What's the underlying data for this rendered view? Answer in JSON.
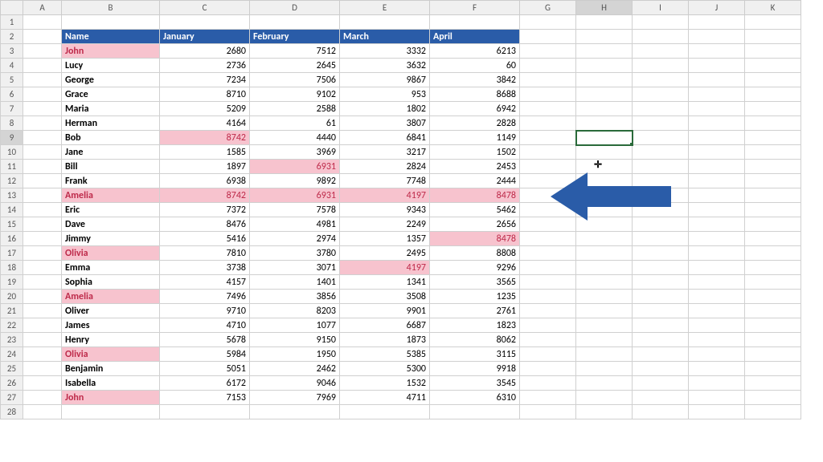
{
  "columns": {
    "A": 48,
    "B": 122,
    "C": 112,
    "D": 112,
    "E": 112,
    "F": 112,
    "G": 70,
    "H": 70,
    "I": 70,
    "J": 70,
    "K": 70
  },
  "header": {
    "name": "Name",
    "jan": "January",
    "feb": "February",
    "mar": "March",
    "apr": "April"
  },
  "rows": [
    {
      "n": "John",
      "jan": 2680,
      "feb": 7512,
      "mar": 3332,
      "apr": 6213,
      "np": true
    },
    {
      "n": "Lucy",
      "jan": 2736,
      "feb": 2645,
      "mar": 3632,
      "apr": 60
    },
    {
      "n": "George",
      "jan": 7234,
      "feb": 7506,
      "mar": 9867,
      "apr": 3842
    },
    {
      "n": "Grace",
      "jan": 8710,
      "feb": 9102,
      "mar": 953,
      "apr": 8688
    },
    {
      "n": "Maria",
      "jan": 5209,
      "feb": 2588,
      "mar": 1802,
      "apr": 6942
    },
    {
      "n": "Herman",
      "jan": 4164,
      "feb": 61,
      "mar": 3807,
      "apr": 2828
    },
    {
      "n": "Bob",
      "jan": 8742,
      "feb": 4440,
      "mar": 6841,
      "apr": 1149,
      "janp": true
    },
    {
      "n": "Jane",
      "jan": 1585,
      "feb": 3969,
      "mar": 3217,
      "apr": 1502
    },
    {
      "n": "Bill",
      "jan": 1897,
      "feb": 6931,
      "mar": 2824,
      "apr": 2453,
      "febp": true
    },
    {
      "n": "Frank",
      "jan": 6938,
      "feb": 9892,
      "mar": 7748,
      "apr": 2444
    },
    {
      "n": "Amelia",
      "jan": 8742,
      "feb": 6931,
      "mar": 4197,
      "apr": 8478,
      "np": true,
      "janp": true,
      "febp": true,
      "marp": true,
      "aprp": true
    },
    {
      "n": "Eric",
      "jan": 7372,
      "feb": 7578,
      "mar": 9343,
      "apr": 5462
    },
    {
      "n": "Dave",
      "jan": 8476,
      "feb": 4981,
      "mar": 2249,
      "apr": 2656
    },
    {
      "n": "Jimmy",
      "jan": 5416,
      "feb": 2974,
      "mar": 1357,
      "apr": 8478,
      "aprp": true
    },
    {
      "n": "Olivia",
      "jan": 7810,
      "feb": 3780,
      "mar": 2495,
      "apr": 8808,
      "np": true
    },
    {
      "n": "Emma",
      "jan": 3738,
      "feb": 3071,
      "mar": 4197,
      "apr": 9296,
      "marp": true
    },
    {
      "n": "Sophia",
      "jan": 4157,
      "feb": 1401,
      "mar": 1341,
      "apr": 3565
    },
    {
      "n": "Amelia",
      "jan": 7496,
      "feb": 3856,
      "mar": 3508,
      "apr": 1235,
      "np": true
    },
    {
      "n": "Oliver",
      "jan": 9710,
      "feb": 8203,
      "mar": 9901,
      "apr": 2761
    },
    {
      "n": "James",
      "jan": 4710,
      "feb": 1077,
      "mar": 6687,
      "apr": 1823
    },
    {
      "n": "Henry",
      "jan": 5678,
      "feb": 9150,
      "mar": 1873,
      "apr": 8062
    },
    {
      "n": "Olivia",
      "jan": 5984,
      "feb": 1950,
      "mar": 5385,
      "apr": 3115,
      "np": true
    },
    {
      "n": "Benjamin",
      "jan": 5051,
      "feb": 2462,
      "mar": 5300,
      "apr": 9918
    },
    {
      "n": "Isabella",
      "jan": 6172,
      "feb": 9046,
      "mar": 1532,
      "apr": 3545
    },
    {
      "n": "John",
      "jan": 7153,
      "feb": 7969,
      "mar": 4711,
      "apr": 6310,
      "np": true
    }
  ],
  "selected": {
    "row": 9,
    "col": "H"
  },
  "cursor": "✛"
}
